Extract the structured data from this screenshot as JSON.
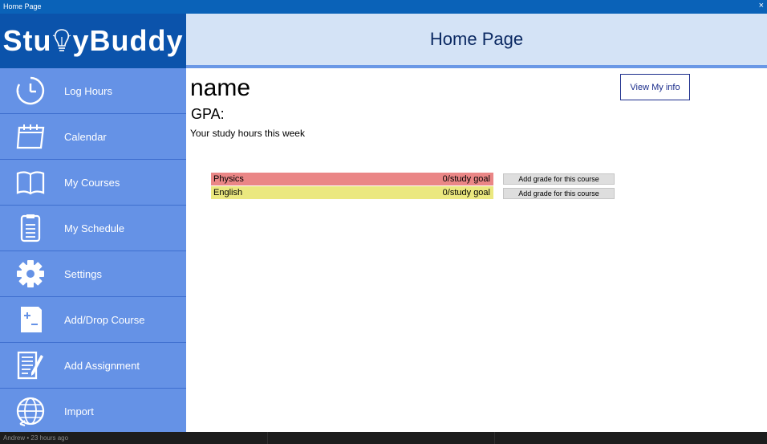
{
  "window": {
    "title": "Home Page",
    "close_glyph": "×"
  },
  "logo": {
    "prefix": "Stu",
    "suffix": "yBuddy"
  },
  "header": {
    "title": "Home Page"
  },
  "sidebar": {
    "items": [
      {
        "label": "Log Hours",
        "icon": "clock-icon"
      },
      {
        "label": "Calendar",
        "icon": "calendar-icon"
      },
      {
        "label": "My Courses",
        "icon": "book-icon"
      },
      {
        "label": "My Schedule",
        "icon": "clipboard-icon"
      },
      {
        "label": "Settings",
        "icon": "gear-icon"
      },
      {
        "label": "Add/Drop Course",
        "icon": "plus-minus-icon"
      },
      {
        "label": "Add Assignment",
        "icon": "document-pen-icon"
      },
      {
        "label": "Import",
        "icon": "globe-icon"
      }
    ]
  },
  "main": {
    "name": "name",
    "gpa_label": "GPA:",
    "study_hours_label": "Your study hours this week",
    "view_info_button": "View My info",
    "courses": [
      {
        "name": "Physics",
        "goal": "0/study goal",
        "color": "#ea8686",
        "button": "Add grade for this course"
      },
      {
        "name": "English",
        "goal": "0/study goal",
        "color": "#ebe87f",
        "button": "Add grade for this course"
      }
    ]
  },
  "taskbar": {
    "status": "Andrew • 23 hours ago"
  },
  "colors": {
    "titlebar": "#0a62b8",
    "logo_bg": "#0b53ab",
    "sidebar_bg": "#6592e6",
    "header_bg": "#d4e3f6",
    "header_border": "#6a98e6",
    "header_text": "#0c2a63"
  }
}
